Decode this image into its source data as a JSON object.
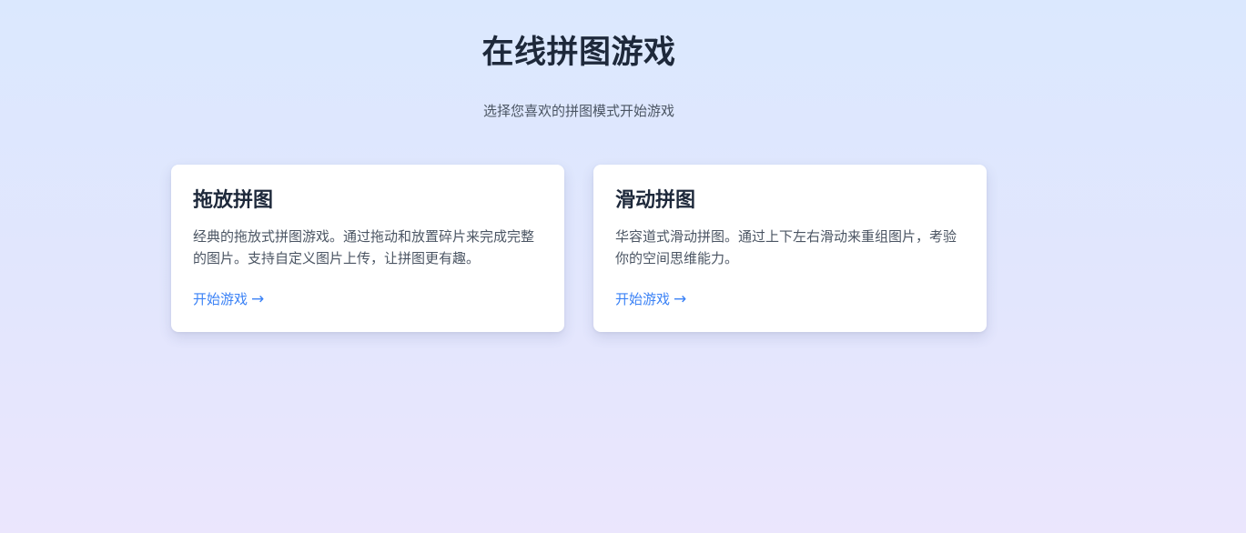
{
  "header": {
    "title": "在线拼图游戏",
    "subtitle": "选择您喜欢的拼图模式开始游戏"
  },
  "cards": [
    {
      "title": "拖放拼图",
      "description": "经典的拖放式拼图游戏。通过拖动和放置碎片来完成完整的图片。支持自定义图片上传，让拼图更有趣。",
      "link_label": "开始游戏",
      "link_icon": "arrow-right-icon"
    },
    {
      "title": "滑动拼图",
      "description": "华容道式滑动拼图。通过上下左右滑动来重组图片，考验你的空间思维能力。",
      "link_label": "开始游戏",
      "link_icon": "arrow-right-icon"
    }
  ],
  "colors": {
    "background_top": "#dbe8fe",
    "background_bottom": "#ebe6fd",
    "card_background": "#ffffff",
    "title_text": "#1e293b",
    "body_text": "#4b5563",
    "link": "#3b82f6"
  }
}
